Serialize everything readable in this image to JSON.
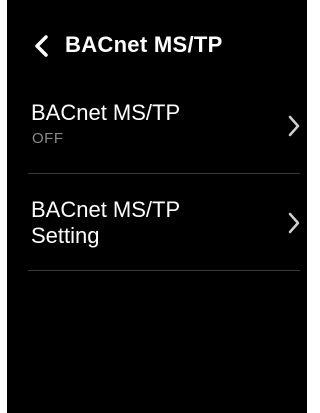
{
  "header": {
    "back_icon": "chevron-left-icon",
    "title": "BACnet MS/TP"
  },
  "menu": {
    "items": [
      {
        "title": "BACnet MS/TP",
        "status": "OFF",
        "icon": "chevron-right-icon"
      },
      {
        "title_line1": "BACnet MS/TP",
        "title_line2": "Setting",
        "icon": "chevron-right-icon"
      }
    ]
  },
  "colors": {
    "background": "#000000",
    "text": "#ffffff",
    "secondary_text": "#8a8a8a",
    "divider": "#3a3a3a"
  }
}
